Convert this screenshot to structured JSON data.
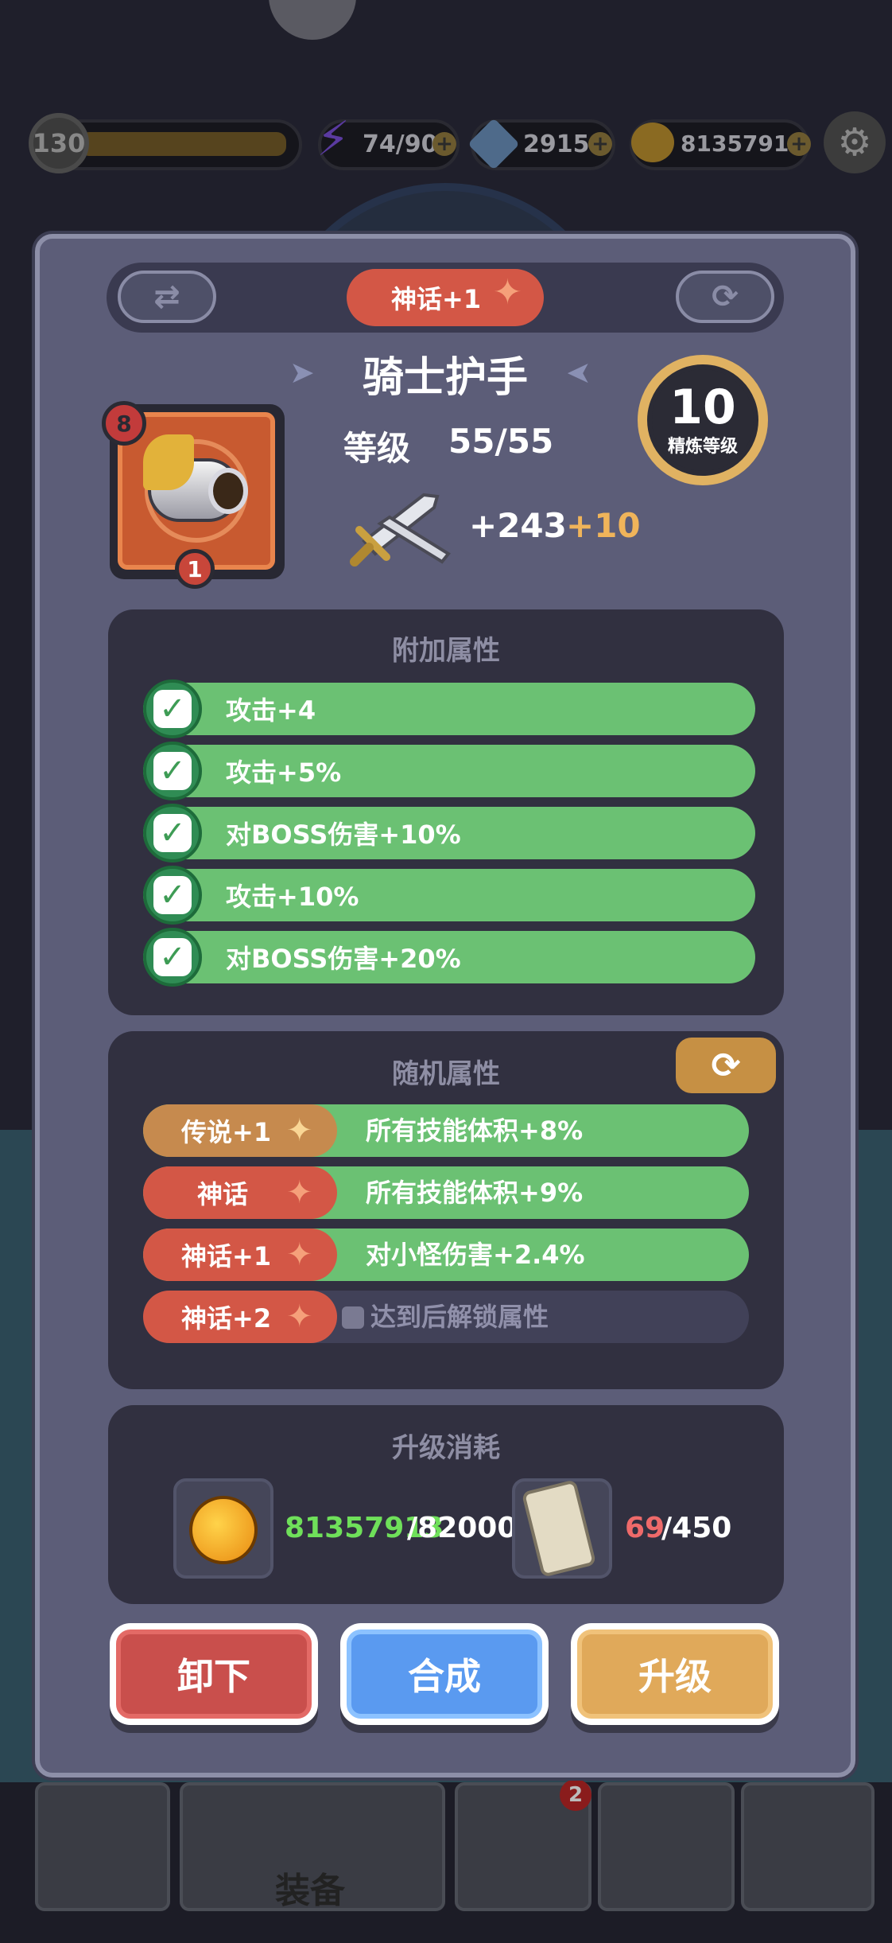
{
  "hud": {
    "player_level": "130",
    "energy": "74/90",
    "gems": "2915",
    "gold": "81357913"
  },
  "header": {
    "rarity": "神话+1",
    "item_name": "骑士护手",
    "level_label": "等级",
    "level_value": "55/55",
    "stat_main": "+243",
    "stat_bonus": "+10",
    "refine_level": "10",
    "refine_label": "精炼等级",
    "badge_top": "8",
    "badge_count": "1"
  },
  "extra_attrs": {
    "title": "附加属性",
    "items": [
      {
        "label": "攻击+4"
      },
      {
        "label": "攻击+5%"
      },
      {
        "label": "对BOSS伤害+10%"
      },
      {
        "label": "攻击+10%"
      },
      {
        "label": "对BOSS伤害+20%"
      }
    ]
  },
  "random_attrs": {
    "title": "随机属性",
    "items": [
      {
        "tag": "传说+1",
        "text": "所有技能体积+8%",
        "tag_color": "#c68a4e",
        "locked": false
      },
      {
        "tag": "神话",
        "text": "所有技能体积+9%",
        "tag_color": "#d35746",
        "locked": false
      },
      {
        "tag": "神话+1",
        "text": "对小怪伤害+2.4%",
        "tag_color": "#d35746",
        "locked": false
      },
      {
        "tag": "神话+2",
        "text": "达到后解锁属性",
        "tag_color": "#d35746",
        "locked": true
      }
    ]
  },
  "upgrade_cost": {
    "title": "升级消耗",
    "gold_have": "81357913",
    "gold_need": "/82000",
    "scroll_have": "69",
    "scroll_need": "/450",
    "have_ok_color": "#6fe05a",
    "have_low_color": "#ee6a6a"
  },
  "actions": {
    "unequip": "卸下",
    "combine": "合成",
    "upgrade": "升级"
  },
  "nav": {
    "equipment_label": "装备",
    "badge_count": "2"
  },
  "colors": {
    "panel": "#5c5d78",
    "section": "#313040",
    "attr_green": "#6bc173",
    "mythic_red": "#d35746",
    "legend_orange": "#c68a4e",
    "accent_gold": "#e0b262"
  }
}
